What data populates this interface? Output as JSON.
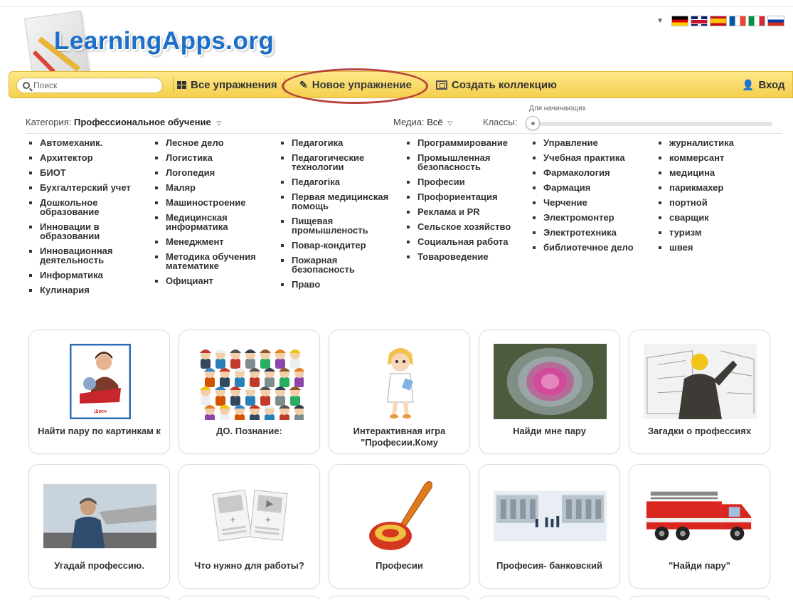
{
  "header": {
    "logo_text": "LearningApps.org",
    "languages": [
      "de",
      "en",
      "es",
      "fr",
      "it",
      "ru"
    ]
  },
  "toolbar": {
    "search_placeholder": "Поиск",
    "all_exercises": "Все упражнения",
    "new_exercise": "Новое упражнение",
    "create_collection": "Создать коллекцию",
    "login": "Вход"
  },
  "filters": {
    "category_label": "Категория:",
    "category_value": "Профессиональное обучение",
    "media_label": "Медиа:",
    "media_value": "Всё",
    "classes_label": "Классы:",
    "slider_label": "Для начинающих",
    "slider_value": 0
  },
  "categories": [
    [
      "Автомеханик.",
      "Архитектор",
      "БИОТ",
      "Бухгалтерский учет",
      "Дошкольное образование",
      "Инновации в образовании",
      "Инновационная деятельность",
      "Информатика",
      "Кулинария"
    ],
    [
      "Лесное дело",
      "Логистика",
      "Логопедия",
      "Маляр",
      "Машиностроение",
      "Медицинская информатика",
      "Менеджмент",
      "Методика обучения математике",
      "Официант"
    ],
    [
      "Педагогика",
      "Педагогические технологии",
      "Педагогіка",
      "Первая медицинская помощь",
      "Пищевая промышленость",
      "Повар-кондитер",
      "Пожарная безопасность",
      "Право"
    ],
    [
      "Программирование",
      "Промышленная безопасность",
      "Професии",
      "Профориентация",
      "Реклама и PR",
      "Сельское хозяйство",
      "Социальная работа",
      "Товароведение"
    ],
    [
      "Управление",
      "Учебная практика",
      "Фармакология",
      "Фармация",
      "Черчение",
      "Электромонтер",
      "Электротехника",
      "библиотечное дело"
    ],
    [
      "журналистика",
      "коммерсант",
      "медицина",
      "парикмахер",
      "портной",
      "сварщик",
      "туризм",
      "швея"
    ]
  ],
  "cards": [
    {
      "title": "Найти пару по картинкам к",
      "icon": "seamstress-picture-icon",
      "thumb_caption": "Швея"
    },
    {
      "title": "ДО. Познание:",
      "icon": "professions-crowd-icon"
    },
    {
      "title": "Интерактивная игра \"Професии.Кому",
      "icon": "doctor-cartoon-icon"
    },
    {
      "title": "Найди мне пару",
      "icon": "ornamental-cabbage-photo-icon"
    },
    {
      "title": "Загадки о профессиях",
      "icon": "architect-worker-photo-icon"
    },
    {
      "title": "Угадай профессию.",
      "icon": "pilot-photo-icon"
    },
    {
      "title": "Что нужно для работы?",
      "icon": "media-placeholder-icon"
    },
    {
      "title": "Професии",
      "icon": "ladle-icon"
    },
    {
      "title": "Професия- банковский",
      "icon": "bank-scene-icon"
    },
    {
      "title": "\"Найди пару\"",
      "icon": "fire-truck-icon"
    }
  ],
  "colors": {
    "toolbar": "#f5cf4e",
    "logo": "#1b6fc8",
    "highlight_ellipse": "#b8433a"
  }
}
